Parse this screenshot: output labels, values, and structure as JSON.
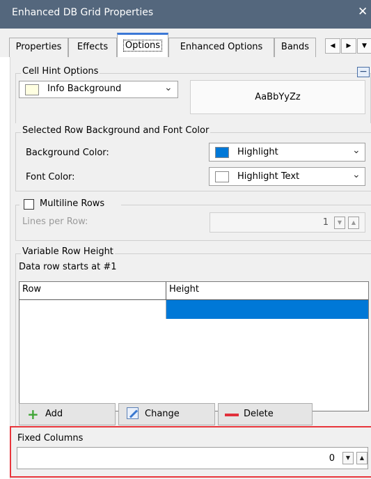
{
  "window": {
    "title": "Enhanced DB Grid Properties",
    "close_glyph": "✕"
  },
  "tabs": [
    {
      "label": "Properties"
    },
    {
      "label": "Effects"
    },
    {
      "label": "Options"
    },
    {
      "label": "Enhanced Options"
    },
    {
      "label": "Bands"
    }
  ],
  "tab_scroll": {
    "left_glyph": "◀",
    "right_glyph": "▶",
    "down_glyph": "▼"
  },
  "cell_hint": {
    "group_label": "Cell Hint Options",
    "combo_value": "Info Background",
    "combo_swatch_color": "#ffffe1",
    "preview_text": "AaBbYyZz",
    "collapse_glyph": "−"
  },
  "selected_row": {
    "group_label": "Selected Row Background and Font Color",
    "background_label": "Background Color:",
    "background_value": "Highlight",
    "background_swatch_color": "#0078d7",
    "font_label": "Font Color:",
    "font_value": "Highlight Text",
    "font_swatch_color": "#ffffff"
  },
  "multiline": {
    "checkbox_label": "Multiline Rows",
    "lines_label": "Lines per Row:",
    "lines_value": "1"
  },
  "variable_height": {
    "group_label": "Variable Row Height",
    "info_text": "Data row starts at #1",
    "columns": [
      "Row",
      "Height"
    ],
    "rows": [
      {
        "row": "",
        "height": ""
      }
    ],
    "highlight_color": "#0078d7"
  },
  "buttons": {
    "add": "Add",
    "change": "Change",
    "delete": "Delete"
  },
  "fixed_columns": {
    "label": "Fixed Columns",
    "value": "0",
    "highlight_border_color": "#e8353b"
  },
  "colors": {
    "titlebar": "#54677d",
    "active_tab_accent": "#3b78d6",
    "add_icon": "#3fa535",
    "delete_icon": "#e1303c",
    "change_icon": "#3a79d0"
  }
}
